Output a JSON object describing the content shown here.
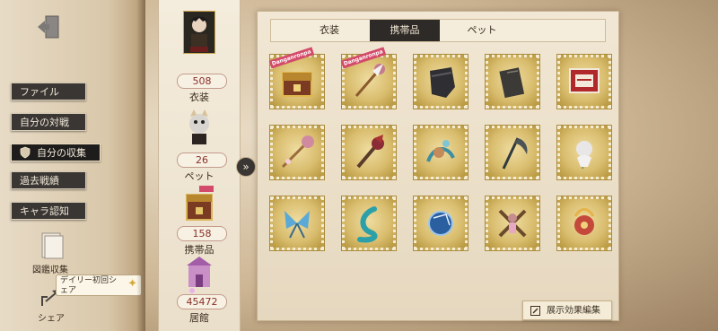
{
  "nav": {
    "items": [
      {
        "label": "ファイル"
      },
      {
        "label": "自分の対戦"
      },
      {
        "label": "自分の収集"
      },
      {
        "label": "過去戦績"
      },
      {
        "label": "キャラ認知"
      }
    ],
    "active_index": 2,
    "book_label": "図鑑収集",
    "share_label": "シェア",
    "tooltip": "デイリー初回シェア"
  },
  "collection": {
    "items": [
      {
        "count": "508",
        "label": "衣装"
      },
      {
        "count": "26",
        "label": "ペット"
      },
      {
        "count": "158",
        "label": "携帯品"
      },
      {
        "count": "45472",
        "label": "居館"
      }
    ]
  },
  "tabs": [
    {
      "label": "衣装"
    },
    {
      "label": "携帯品"
    },
    {
      "label": "ペット"
    }
  ],
  "active_tab": 1,
  "items": [
    {
      "icon": "treasure-box-icon",
      "badge": "Danganronpa",
      "color": "#7a3b22"
    },
    {
      "icon": "wand-icon",
      "badge": "Danganronpa",
      "color": "#c47b8e"
    },
    {
      "icon": "black-pouch-icon",
      "badge": "",
      "color": "#2f2f33"
    },
    {
      "icon": "notebook-icon",
      "badge": "",
      "color": "#3c3a36"
    },
    {
      "icon": "red-card-icon",
      "badge": "",
      "color": "#b0282a"
    },
    {
      "icon": "pink-staff-icon",
      "badge": "",
      "color": "#d08aa0"
    },
    {
      "icon": "ribbon-torch-icon",
      "badge": "",
      "color": "#8a2c36"
    },
    {
      "icon": "cat-scroll-icon",
      "badge": "",
      "color": "#3c8ea0"
    },
    {
      "icon": "scythe-icon",
      "badge": "",
      "color": "#2f3a3c"
    },
    {
      "icon": "white-lily-icon",
      "badge": "",
      "color": "#e9e6e8"
    },
    {
      "icon": "blue-butterfly-icon",
      "badge": "",
      "color": "#5aa9d6"
    },
    {
      "icon": "teal-tail-icon",
      "badge": "",
      "color": "#2ba0a8"
    },
    {
      "icon": "crystal-orb-icon",
      "badge": "",
      "color": "#2a5fa0"
    },
    {
      "icon": "cross-doll-icon",
      "badge": "",
      "color": "#c68d8f"
    },
    {
      "icon": "red-ornament-icon",
      "badge": "",
      "color": "#c4493b"
    }
  ],
  "summary_label": "展示効果編集"
}
